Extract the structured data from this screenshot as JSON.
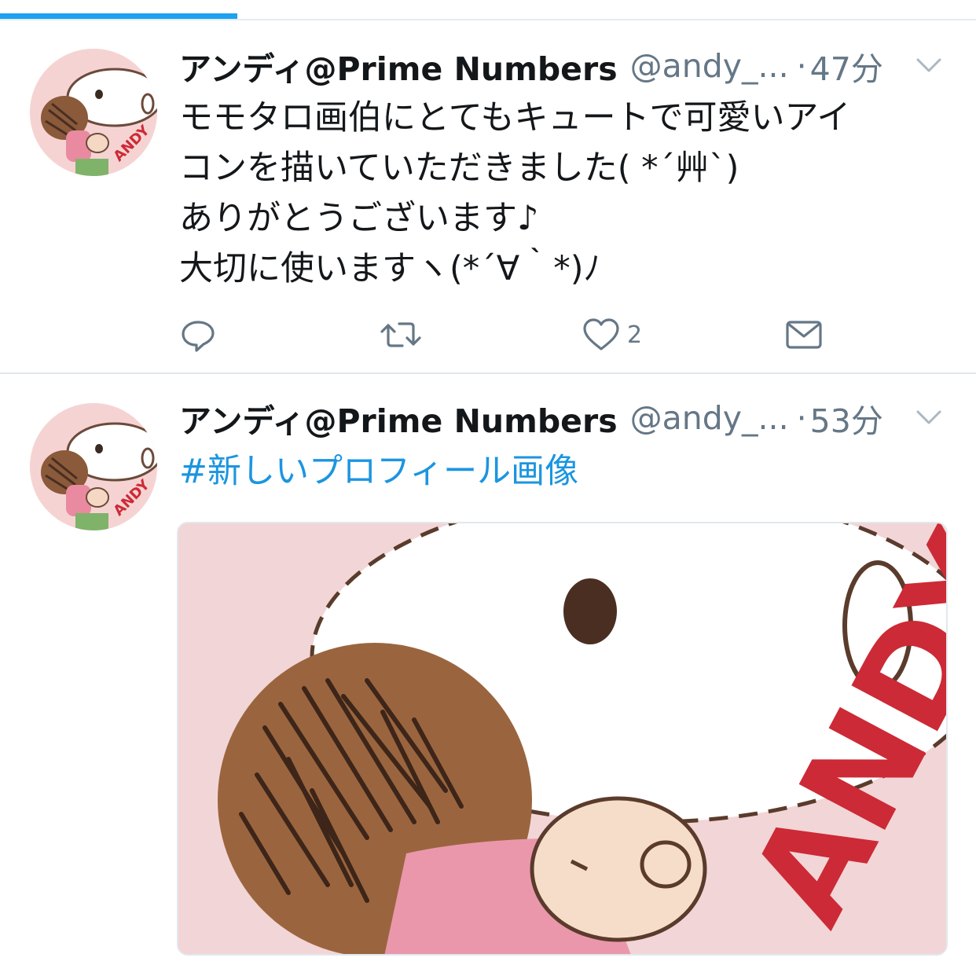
{
  "tab_bar": {
    "accent_color": "#1da1f2"
  },
  "tweets": [
    {
      "author_name": "アンディ@Prime Numbers",
      "handle": "@andy_...",
      "separator": "·",
      "time": "47分",
      "lines": [
        "モモタロ画伯にとてもキュートで可愛いアイ",
        "コンを描いていただきました( *´艸`)",
        "ありがとうございます♪",
        "大切に使いますヽ(*´∀｀*)ﾉ"
      ],
      "actions": {
        "reply_icon": "reply-icon",
        "retweet_icon": "retweet-icon",
        "like_icon": "heart-icon",
        "like_count": "2",
        "dm_icon": "mail-icon"
      }
    },
    {
      "author_name": "アンディ@Prime Numbers",
      "handle": "@andy_...",
      "separator": "·",
      "time": "53分",
      "hashtag": "#新しいプロフィール画像",
      "media_text": "ANDY"
    }
  ],
  "avatar_text": "ANDY",
  "colors": {
    "text_primary": "#14171a",
    "text_secondary": "#657786",
    "link": "#1b95e0",
    "divider": "#e1e8ed",
    "avatar_bg": "#f6d3d3",
    "andy_red": "#cc2a36"
  }
}
